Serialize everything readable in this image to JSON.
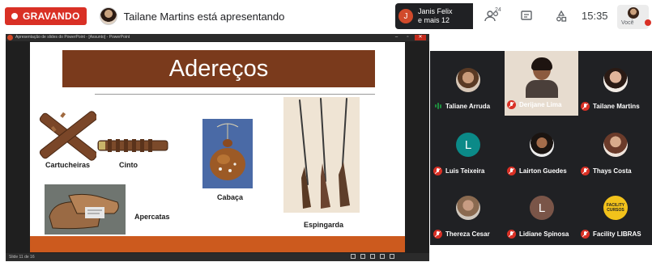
{
  "meet": {
    "recording_label": "GRAVANDO",
    "presenter_text": "Tailane Martins está apresentando",
    "join_notice": {
      "avatar_letter": "J",
      "line1": "Janis Felix",
      "line2": "e mais 12"
    },
    "people_count": "24",
    "time": "15:35",
    "self_label": "Você"
  },
  "powerpoint": {
    "window_title": "Apresentação de slides do PowerPoint - [Assunto] - PowerPoint",
    "status_text": "Slide 11 de 16",
    "slide": {
      "title": "Adereços",
      "captions": {
        "cartucheiras": "Cartucheiras",
        "cinto": "Cinto",
        "cabaca": "Cabaça",
        "apercatas": "Apercatas",
        "espingarda": "Espingarda"
      },
      "colors": {
        "title_band": "#7a3a1c",
        "footer": "#cc5a1e"
      }
    }
  },
  "participants": [
    {
      "name": "Taliane Arruda",
      "mic": "speaking"
    },
    {
      "name": "Derijane Lima",
      "mic": "muted",
      "featured": true
    },
    {
      "name": "Tailane Martins",
      "mic": "muted"
    },
    {
      "name": "Luis Teixeira",
      "mic": "muted",
      "avatar_letter": "L",
      "avatar_color": "#0b8a88"
    },
    {
      "name": "Lairton Guedes",
      "mic": "muted"
    },
    {
      "name": "Thays Costa",
      "mic": "muted"
    },
    {
      "name": "Thereza Cesar",
      "mic": "muted"
    },
    {
      "name": "Lidiane Spinosa",
      "mic": "muted",
      "avatar_letter": "L",
      "avatar_color": "#7a5548"
    },
    {
      "name": "Facility LIBRAS",
      "mic": "muted",
      "avatar_text": "FACILITY CURSOS"
    }
  ],
  "colors": {
    "recording": "#d93025",
    "grid_bg": "#202124",
    "speaking": "#1e8e3e"
  }
}
